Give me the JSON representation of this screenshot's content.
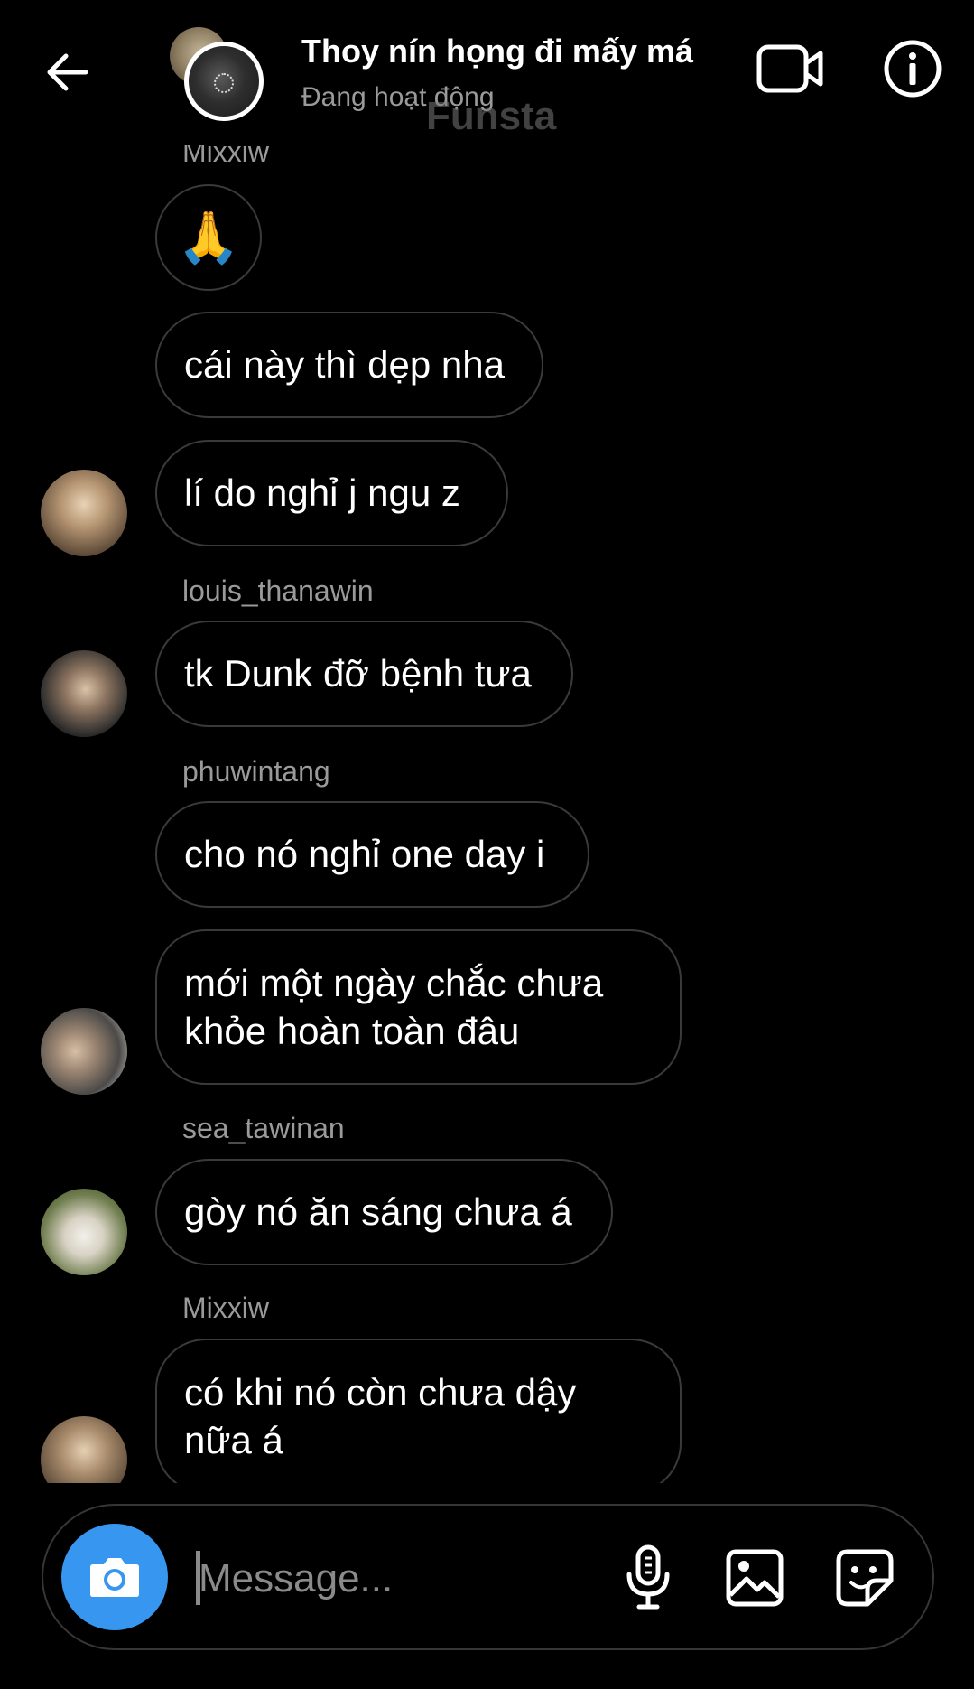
{
  "header": {
    "title": "Thoy nín họng đi mấy má",
    "status": "Đang hoạt động",
    "watermark": "Funsta",
    "icons": {
      "back": "back-arrow-icon",
      "video": "video-call-icon",
      "info": "info-icon"
    }
  },
  "messages": [
    {
      "sender": "Mixxiw"
    },
    {
      "emoji": "🙏"
    },
    {
      "text": "cái này thì dẹp nha"
    },
    {
      "text": "lí do nghỉ j ngu z"
    },
    {
      "sender": "louis_thanawin"
    },
    {
      "text": "tk Dunk đỡ bệnh tưa"
    },
    {
      "sender": "phuwintang"
    },
    {
      "text": "cho nó nghỉ one day i"
    },
    {
      "text": "mới một ngày chắc chưa khỏe hoàn toàn đâu"
    },
    {
      "sender": "sea_tawinan"
    },
    {
      "text": "gòy nó ăn sáng chưa á"
    },
    {
      "sender": "Mixxiw"
    },
    {
      "text": "có khi nó còn chưa dậy nữa á"
    }
  ],
  "composer": {
    "placeholder": "Message...",
    "icons": {
      "camera": "camera-icon",
      "mic": "microphone-icon",
      "gallery": "gallery-icon",
      "sticker": "sticker-icon"
    },
    "accent_color": "#3797f0"
  }
}
